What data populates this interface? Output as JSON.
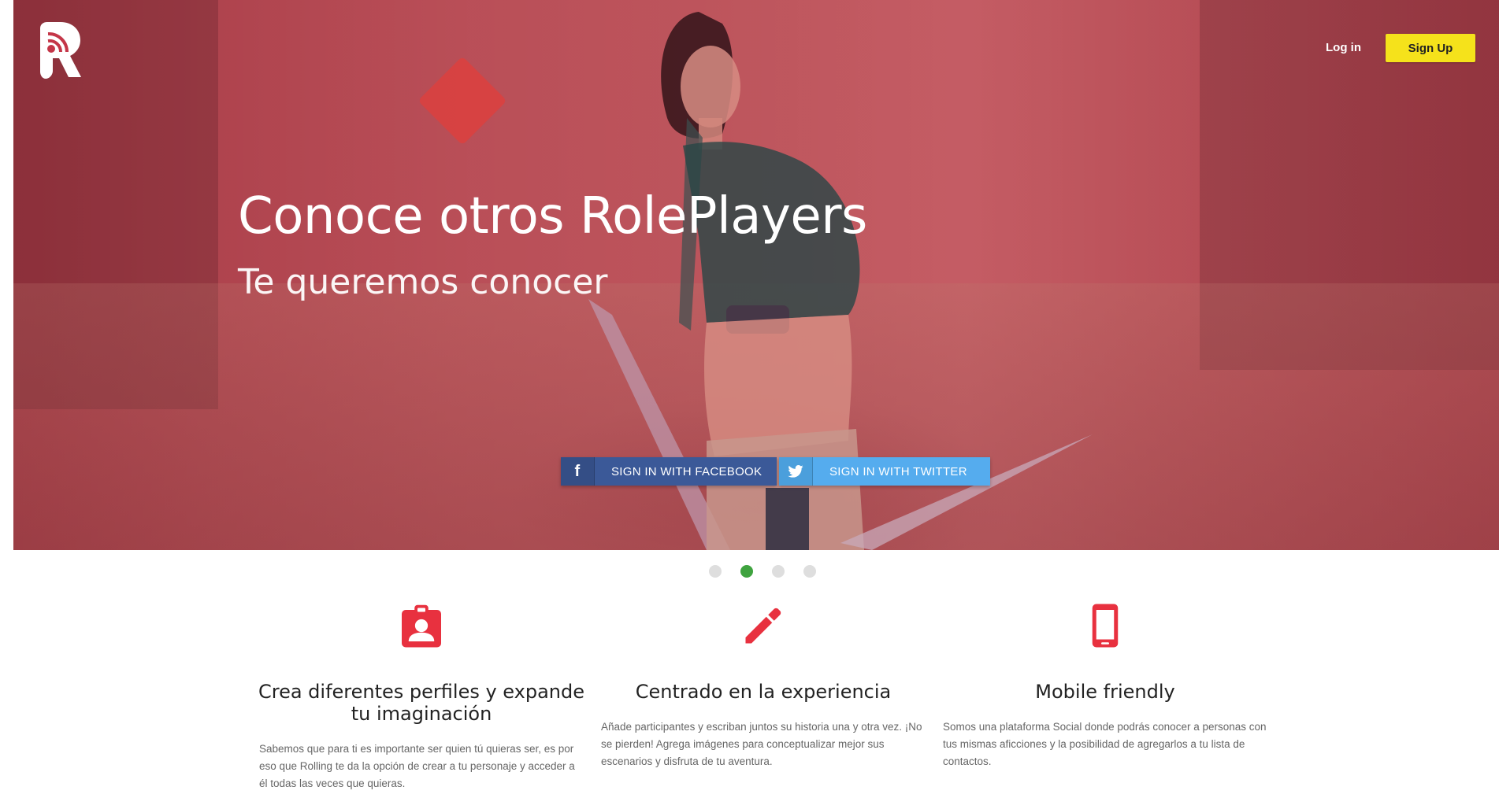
{
  "header": {
    "logo_letter": "R",
    "login_label": "Log in",
    "signup_label": "Sign Up"
  },
  "hero": {
    "title": "Conoce otros RolePlayers",
    "subtitle": "Te queremos conocer",
    "facebook_label": "SIGN IN WITH FACEBOOK",
    "twitter_label": "SIGN IN WITH TWITTER",
    "facebook_icon": "f",
    "overlay_color": "#c43648"
  },
  "carousel": {
    "slides": 4,
    "active_index": 1
  },
  "features": [
    {
      "icon": "contact-badge-icon",
      "title": "Crea diferentes perfiles y expande tu imaginación",
      "text": "Sabemos que para ti es importante ser quien tú quieras ser, es por eso que Rolling te da la opción de crear a tu personaje y acceder a él todas las veces que quieras."
    },
    {
      "icon": "pencil-icon",
      "title": "Centrado en la experiencia",
      "text": "Añade participantes y escriban juntos su historia una y otra vez. ¡No se pierden! Agrega imágenes para conceptualizar mejor sus escenarios y disfruta de tu aventura."
    },
    {
      "icon": "smartphone-icon",
      "title": "Mobile friendly",
      "text": "Somos una plataforma Social donde podrás conocer a personas con tus mismas aficciones y la posibilidad de agregarlos a tu lista de contactos."
    }
  ],
  "colors": {
    "accent_red": "#e8313f",
    "signup_yellow": "#f5e21b",
    "facebook_blue": "#3b5998",
    "twitter_blue": "#55acee",
    "active_dot_green": "#3fa33f"
  }
}
